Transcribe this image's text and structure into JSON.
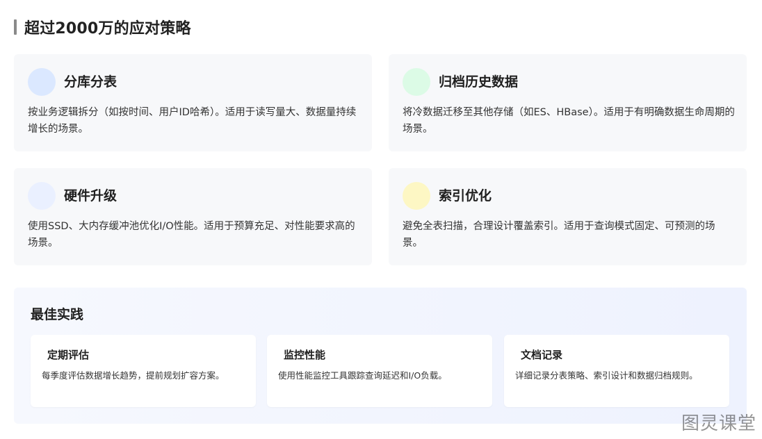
{
  "header": {
    "title": "超过2000万的应对策略"
  },
  "cards": [
    {
      "title": "分库分表",
      "desc": "按业务逻辑拆分（如按时间、用户ID哈希）。适用于读写量大、数据量持续增长的场景。",
      "icon": "blue-circle-icon",
      "color": "#dbe8ff"
    },
    {
      "title": "归档历史数据",
      "desc": "将冷数据迁移至其他存储（如ES、HBase）。适用于有明确数据生命周期的场景。",
      "icon": "green-circle-icon",
      "color": "#dcfbe6"
    },
    {
      "title": "硬件升级",
      "desc": "使用SSD、大内存缓冲池优化I/O性能。适用于预算充足、对性能要求高的场景。",
      "icon": "lavender-circle-icon",
      "color": "#eaf0ff"
    },
    {
      "title": "索引优化",
      "desc": "避免全表扫描，合理设计覆盖索引。适用于查询模式固定、可预测的场景。",
      "icon": "yellow-circle-icon",
      "color": "#fdf7c4"
    }
  ],
  "best_practices": {
    "title": "最佳实践",
    "items": [
      {
        "title": "定期评估",
        "desc": "每季度评估数据增长趋势，提前规划扩容方案。"
      },
      {
        "title": "监控性能",
        "desc": "使用性能监控工具跟踪查询延迟和I/O负载。"
      },
      {
        "title": "文档记录",
        "desc": "详细记录分表策略、索引设计和数据归档规则。"
      }
    ]
  },
  "watermark": "图灵课堂"
}
